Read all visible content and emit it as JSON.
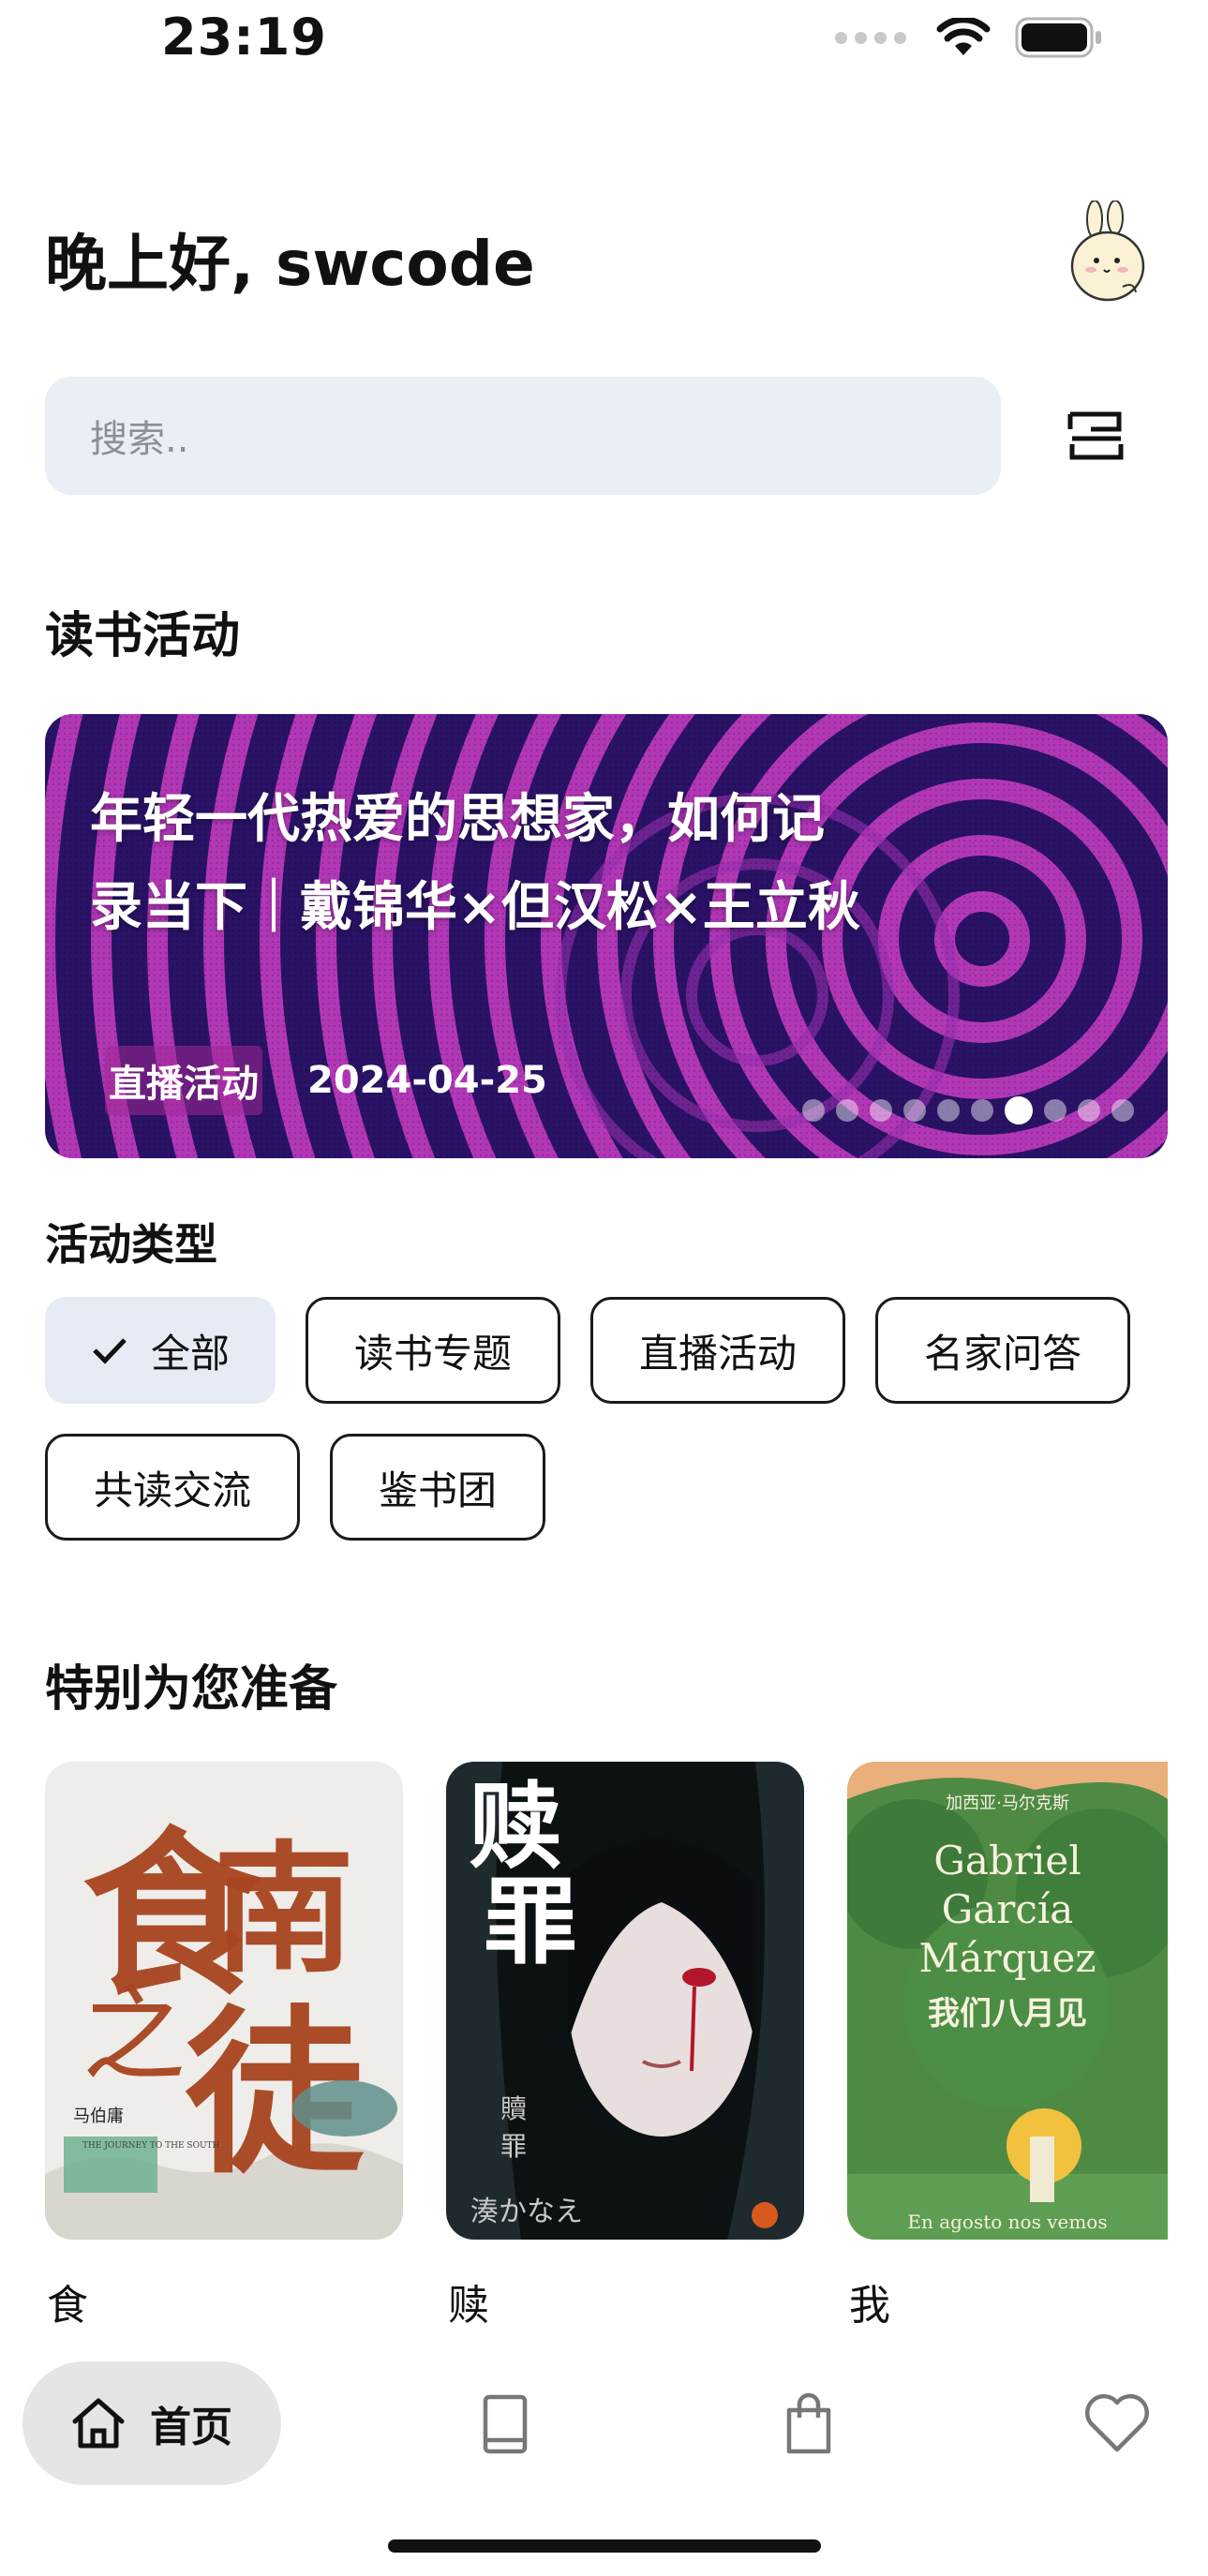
{
  "status_bar": {
    "time": "23:19"
  },
  "header": {
    "greeting": "晚上好, swcode"
  },
  "search": {
    "placeholder": "搜索.."
  },
  "activities": {
    "section_title": "读书活动",
    "banner": {
      "title_line1": "年轻一代热爱的思想家，如何记",
      "title_line2": "录当下｜戴锦华×但汉松×王立秋",
      "tag": "直播活动",
      "date": "2024-04-25",
      "page_count": 10,
      "active_page": 7
    }
  },
  "activity_types": {
    "title": "活动类型",
    "chips": [
      {
        "label": "全部",
        "selected": true
      },
      {
        "label": "读书专题",
        "selected": false
      },
      {
        "label": "直播活动",
        "selected": false
      },
      {
        "label": "名家问答",
        "selected": false
      },
      {
        "label": "共读交流",
        "selected": false
      },
      {
        "label": "鉴书团",
        "selected": false
      }
    ]
  },
  "recommended": {
    "title": "特别为您准备",
    "books": [
      {
        "label": "食",
        "cover_main": "食南之徒",
        "cover_author": "马伯庸",
        "cover_en": "THE JOURNEY TO THE SOUTH"
      },
      {
        "label": "赎",
        "cover_main": "赎罪",
        "cover_vertical": "贖罪",
        "cover_author": "湊かなえ"
      },
      {
        "label": "我",
        "cover_author": "加西亚·马尔克斯",
        "cover_en_1": "Gabriel",
        "cover_en_2": "García",
        "cover_en_3": "Márquez",
        "cover_main": "我们八月见",
        "cover_es": "En agosto nos vemos"
      }
    ]
  },
  "bottom_nav": {
    "home_label": "首页"
  },
  "colors": {
    "search_bg": "#eaeef5",
    "chip_selected_bg": "#e6ebf4",
    "nav_active_bg": "#e5e5e5",
    "banner_purple": "#2a1266",
    "banner_magenta": "#c13cc0"
  }
}
